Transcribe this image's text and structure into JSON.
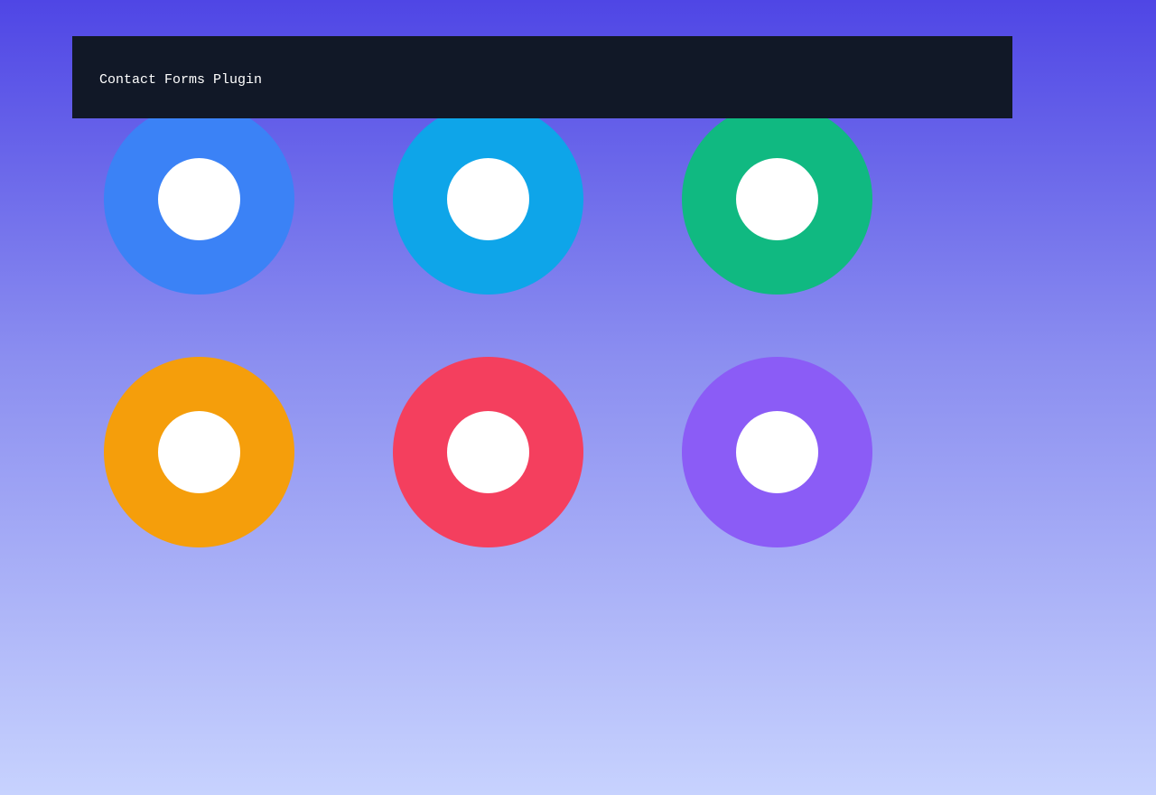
{
  "header": {
    "title": "Contact Forms Plugin"
  },
  "rings": [
    {
      "name": "blue",
      "color": "#3b82f6"
    },
    {
      "name": "sky",
      "color": "#0ea5e9"
    },
    {
      "name": "green",
      "color": "#10b981"
    },
    {
      "name": "amber",
      "color": "#f59e0b"
    },
    {
      "name": "rose",
      "color": "#f43f5e"
    },
    {
      "name": "violet",
      "color": "#8b5cf6"
    }
  ]
}
